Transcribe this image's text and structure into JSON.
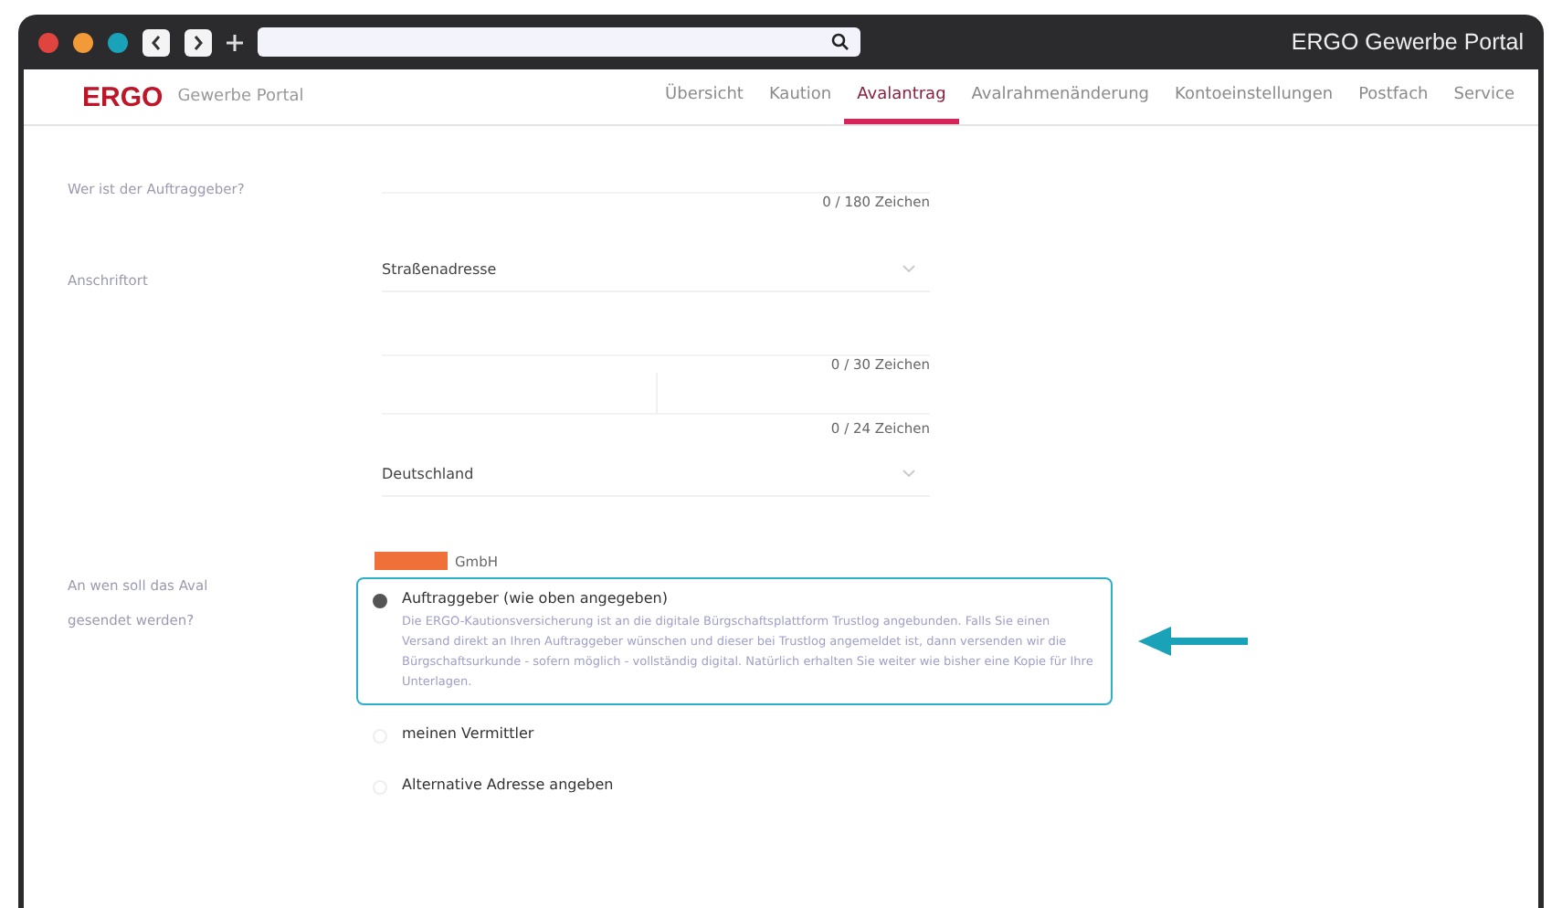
{
  "browser": {
    "title": "ERGO Gewerbe Portal"
  },
  "brand": {
    "logo": "ERGO",
    "subtitle": "Gewerbe Portal"
  },
  "nav": [
    {
      "label": "Übersicht",
      "selected": false
    },
    {
      "label": "Kaution",
      "selected": false
    },
    {
      "label": "Avalantrag",
      "selected": true
    },
    {
      "label": "Avalrahmenänderung",
      "selected": false
    },
    {
      "label": "Kontoeinstellungen",
      "selected": false
    },
    {
      "label": "Postfach",
      "selected": false
    },
    {
      "label": "Service",
      "selected": false
    }
  ],
  "auftraggeber": {
    "label": "Wer ist der Auftraggeber?",
    "counter": "0 / 180 Zeichen"
  },
  "anschrift": {
    "label": "Anschriftort",
    "address_type": "Straßenadresse",
    "counter_street": "0 / 30 Zeichen",
    "counter_city": "0 / 24 Zeichen",
    "country": "Deutschland"
  },
  "versand": {
    "label": "An wen soll das Aval gesendet werden?",
    "company_suffix": "GmbH",
    "options": [
      {
        "label": "Auftraggeber (wie oben angegeben)",
        "selected": true,
        "description": "Die ERGO-Kautionsversicherung ist an die digitale Bürgschaftsplattform Trustlog angebunden. Falls Sie einen Versand direkt an Ihren Auftraggeber wünschen und dieser bei Trustlog angemeldet ist, dann versenden wir die Bürgschaftsurkunde - sofern möglich - vollständig digital. Natürlich erhalten Sie weiter wie bisher eine Kopie für Ihre Unterlagen."
      },
      {
        "label": "meinen Vermittler",
        "selected": false
      },
      {
        "label": "Alternative Adresse angeben",
        "selected": false
      }
    ]
  }
}
